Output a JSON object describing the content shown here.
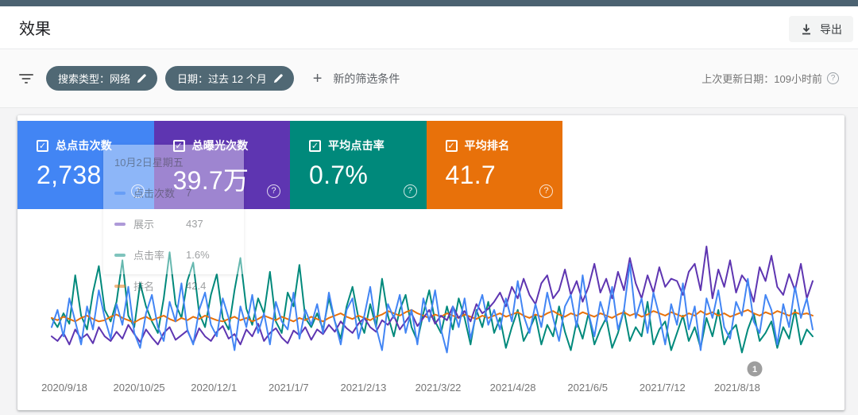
{
  "header": {
    "title": "效果",
    "export_label": "导出"
  },
  "filters": {
    "chips": [
      {
        "label": "搜索类型：网络"
      },
      {
        "label": "日期：过去 12 个月"
      }
    ],
    "add_filter_label": "新的筛选条件",
    "last_updated": "上次更新日期：109小时前"
  },
  "cards": [
    {
      "id": "clicks",
      "label": "总点击次数",
      "value": "2,738",
      "color": "#4285f4"
    },
    {
      "id": "impressions",
      "label": "总曝光次数",
      "value": "39.7万",
      "color": "#5e35b1"
    },
    {
      "id": "ctr",
      "label": "平均点击率",
      "value": "0.7%",
      "color": "#00897b"
    },
    {
      "id": "position",
      "label": "平均排名",
      "value": "41.7",
      "color": "#e8710a"
    }
  ],
  "tooltip_ghost": {
    "title": "10月2日星期五",
    "rows": [
      {
        "label": "点击次数",
        "value": "7",
        "color": "#4285f4"
      },
      {
        "label": "展示",
        "value": "437",
        "color": "#5e35b1"
      },
      {
        "label": "点击率",
        "value": "1.6%",
        "color": "#00897b"
      },
      {
        "label": "排名",
        "value": "42.4",
        "color": "#e8710a"
      }
    ]
  },
  "chart_data": {
    "type": "line",
    "title": "",
    "x_labels": [
      "2020/9/18",
      "2020/10/25",
      "2020/12/1",
      "2021/1/7",
      "2021/2/13",
      "2021/3/22",
      "2021/4/28",
      "2021/6/5",
      "2021/7/12",
      "2021/8/18"
    ],
    "pagination_badge": "1",
    "badge_color": "#9e9e9e",
    "grid": false,
    "note": "values are normalized plot heights 0-100 read from pixels (4 daily series over 12 months)",
    "series": [
      {
        "id": "ctr",
        "name": "平均点击率",
        "color": "#00897b",
        "values": [
          38,
          30,
          42,
          33,
          75,
          40,
          28,
          60,
          83,
          45,
          35,
          52,
          88,
          40,
          30,
          68,
          48,
          35,
          25,
          55,
          95,
          50,
          38,
          70,
          86,
          42,
          30,
          58,
          76,
          38,
          28,
          62,
          90,
          46,
          32,
          55,
          42,
          78,
          35,
          25,
          60,
          48,
          84,
          38,
          30,
          42,
          28,
          55,
          35,
          20,
          48,
          65,
          38,
          25,
          50,
          30,
          72,
          40,
          22,
          45,
          58,
          30,
          18,
          42,
          62,
          35,
          25,
          48,
          28,
          55,
          38,
          15,
          45,
          30,
          52,
          25,
          38,
          12,
          30,
          45,
          18,
          28,
          40,
          15,
          32,
          22,
          48,
          26,
          10,
          35,
          20,
          42,
          15,
          28,
          38,
          12,
          25,
          45,
          18,
          30,
          22,
          52,
          15,
          28,
          35,
          10,
          25,
          40,
          18,
          30,
          12,
          38,
          22,
          45,
          15,
          26,
          32,
          8,
          28,
          42,
          18,
          25,
          35,
          12,
          30,
          20,
          45,
          15,
          28,
          22
        ]
      },
      {
        "id": "position",
        "name": "平均排名",
        "color": "#e8710a",
        "values": [
          38,
          36,
          39,
          37,
          35,
          38,
          40,
          37,
          35,
          36,
          39,
          41,
          38,
          36,
          34,
          37,
          39,
          36,
          38,
          40,
          37,
          35,
          38,
          36,
          39,
          37,
          40,
          38,
          36,
          35,
          37,
          39,
          36,
          38,
          35,
          37,
          40,
          38,
          36,
          39,
          37,
          35,
          38,
          36,
          39,
          37,
          35,
          38,
          40,
          42,
          39,
          37,
          40,
          38,
          36,
          39,
          41,
          44,
          42,
          40,
          43,
          45,
          42,
          40,
          38,
          41,
          39,
          42,
          40,
          38,
          41,
          39,
          37,
          40,
          38,
          40,
          42,
          39,
          41,
          43,
          40,
          38,
          41,
          39,
          42,
          44,
          41,
          39,
          42,
          40,
          43,
          41,
          39,
          42,
          40,
          38,
          41,
          43,
          40,
          42,
          39,
          41,
          44,
          42,
          40,
          43,
          41,
          39,
          42,
          40,
          44,
          41,
          43,
          40,
          42,
          39,
          41,
          43,
          45,
          42,
          40,
          43,
          41,
          44,
          42,
          40,
          43,
          41,
          42,
          40
        ]
      },
      {
        "id": "impressions",
        "name": "总曝光次数",
        "color": "#5e35b1",
        "values": [
          22,
          18,
          25,
          15,
          28,
          20,
          24,
          16,
          30,
          22,
          18,
          26,
          20,
          32,
          24,
          17,
          28,
          21,
          15,
          25,
          30,
          19,
          23,
          27,
          16,
          29,
          22,
          18,
          26,
          31,
          20,
          24,
          15,
          28,
          22,
          33,
          18,
          25,
          29,
          21,
          16,
          27,
          23,
          30,
          19,
          28,
          24,
          32,
          26,
          35,
          29,
          25,
          33,
          38,
          30,
          26,
          36,
          32,
          40,
          28,
          35,
          42,
          31,
          38,
          45,
          33,
          40,
          36,
          48,
          38,
          44,
          35,
          50,
          42,
          46,
          52,
          60,
          48,
          65,
          55,
          72,
          58,
          50,
          68,
          75,
          55,
          62,
          80,
          58,
          70,
          52,
          65,
          85,
          60,
          72,
          55,
          78,
          62,
          90,
          68,
          55,
          75,
          60,
          82,
          65,
          72,
          70,
          58,
          78,
          85,
          62,
          100,
          55,
          80,
          65,
          88,
          60,
          75,
          68,
          52,
          82,
          70,
          92,
          65,
          58,
          76,
          62,
          85,
          55,
          70
        ]
      },
      {
        "id": "clicks",
        "name": "总点击次数",
        "color": "#4285f4",
        "values": [
          30,
          45,
          22,
          55,
          35,
          15,
          48,
          28,
          62,
          38,
          20,
          50,
          32,
          65,
          25,
          12,
          42,
          58,
          30,
          18,
          52,
          35,
          68,
          28,
          15,
          45,
          60,
          32,
          22,
          55,
          38,
          10,
          48,
          30,
          58,
          25,
          42,
          15,
          52,
          35,
          28,
          60,
          20,
          45,
          32,
          50,
          25,
          60,
          35,
          15,
          45,
          55,
          20,
          40,
          65,
          30,
          10,
          50,
          38,
          58,
          25,
          45,
          15,
          55,
          35,
          62,
          28,
          8,
          48,
          30,
          55,
          20,
          42,
          58,
          32,
          45,
          28,
          55,
          35,
          70,
          40,
          25,
          50,
          30,
          60,
          38,
          18,
          48,
          58,
          30,
          75,
          42,
          22,
          52,
          35,
          65,
          28,
          45,
          85,
          38,
          55,
          25,
          60,
          40,
          15,
          50,
          32,
          68,
          28,
          48,
          10,
          55,
          38,
          62,
          30,
          20,
          52,
          40,
          72,
          35,
          25,
          58,
          45,
          15,
          50,
          30,
          65,
          38,
          55,
          28
        ]
      }
    ]
  }
}
